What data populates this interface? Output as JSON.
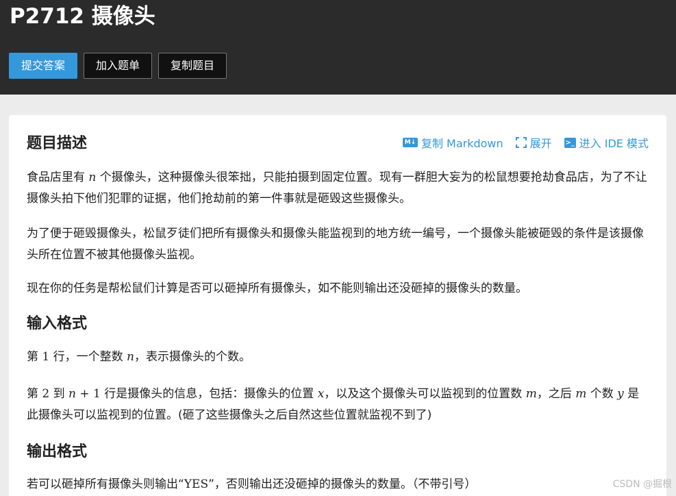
{
  "header": {
    "title": "P2712 摄像头",
    "buttons": {
      "submit": "提交答案",
      "add_to_list": "加入题单",
      "copy_problem": "复制题目"
    }
  },
  "tools": {
    "copy_markdown": "复制 Markdown",
    "expand": "展开",
    "ide_mode": "进入 IDE 模式",
    "md_icon_text": "M↓",
    "ide_icon_text": ">_"
  },
  "sections": {
    "description": {
      "title": "题目描述",
      "p1_a": "食品店里有 ",
      "p1_var": "n",
      "p1_b": " 个摄像头，这种摄像头很笨拙，只能拍摄到固定位置。现有一群胆大妄为的松鼠想要抢劫食品店，为了不让摄像头拍下他们犯罪的证据，他们抢劫前的第一件事就是砸毁这些摄像头。",
      "p2": "为了便于砸毁摄像头，松鼠歹徒们把所有摄像头和摄像头能监视到的地方统一编号，一个摄像头能被砸毁的条件是该摄像头所在位置不被其他摄像头监视。",
      "p3": "现在你的任务是帮松鼠们计算是否可以砸掉所有摄像头，如不能则输出还没砸掉的摄像头的数量。"
    },
    "input": {
      "title": "输入格式",
      "l1_a": "第 ",
      "l1_num": "1",
      "l1_b": " 行，一个整数 ",
      "l1_var": "n",
      "l1_c": "，表示摄像头的个数。",
      "l2_a": "第 ",
      "l2_num": "2",
      "l2_b": " 到 ",
      "l2_expr_var": "n",
      "l2_expr_rest": " + 1",
      "l2_c": " 行是摄像头的信息，包括：摄像头的位置 ",
      "l2_var_x": "x",
      "l2_d": "，以及这个摄像头可以监视到的位置数 ",
      "l2_var_m": "m",
      "l2_e": "，之后 ",
      "l2_var_m2": "m",
      "l2_f": " 个数 ",
      "l2_var_y": "y",
      "l2_g": " 是此摄像头可以监视到的位置。(砸了这些摄像头之后自然这些位置就监视不到了)"
    },
    "output": {
      "title": "输出格式",
      "text_a": "若可以砸掉所有摄像头则输出“",
      "text_code": "YES",
      "text_b": "”，否则输出还没砸掉的摄像头的数量。（不带引号）"
    }
  },
  "watermark": "CSDN @掘根"
}
